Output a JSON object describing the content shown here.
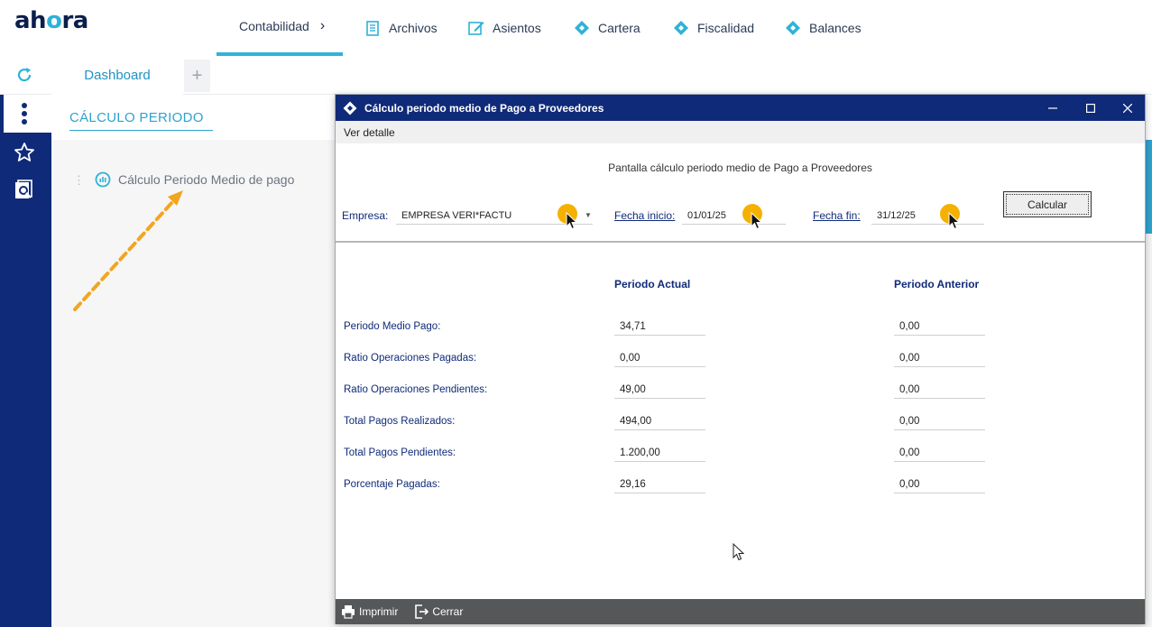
{
  "app": {
    "logo": "ahora"
  },
  "nav": {
    "tabs": [
      {
        "label": "Contabilidad",
        "icon": "chevron-right-icon"
      },
      {
        "label": "Archivos",
        "icon": "document-icon"
      },
      {
        "label": "Asientos",
        "icon": "edit-icon"
      },
      {
        "label": "Cartera",
        "icon": "ahora-diamond-icon"
      },
      {
        "label": "Fiscalidad",
        "icon": "ahora-diamond-icon"
      },
      {
        "label": "Balances",
        "icon": "ahora-diamond-icon"
      }
    ]
  },
  "tabs": {
    "dashboard": "Dashboard",
    "add": "+"
  },
  "main": {
    "section_title": "CÁLCULO PERIODO",
    "menu_item": "Cálculo Periodo Medio de pago"
  },
  "dialog": {
    "title": "Cálculo periodo medio de Pago a Proveedores",
    "menu": "Ver detalle",
    "subtitle": "Pantalla cálculo periodo medio de Pago a Proveedores",
    "empresa_label": "Empresa:",
    "empresa_value": "EMPRESA VERI*FACTU",
    "fecha_inicio_label": "Fecha inicio:",
    "fecha_inicio_value": "01/01/25",
    "fecha_fin_label": "Fecha fin:",
    "fecha_fin_value": "31/12/25",
    "calcular": "Calcular",
    "col_actual": "Periodo Actual",
    "col_anterior": "Periodo Anterior",
    "rows": [
      {
        "label": "Periodo Medio Pago:",
        "actual": "34,71",
        "anterior": "0,00"
      },
      {
        "label": "Ratio Operaciones Pagadas:",
        "actual": "0,00",
        "anterior": "0,00"
      },
      {
        "label": "Ratio Operaciones Pendientes:",
        "actual": "49,00",
        "anterior": "0,00"
      },
      {
        "label": "Total Pagos Realizados:",
        "actual": "494,00",
        "anterior": "0,00"
      },
      {
        "label": "Total Pagos Pendientes:",
        "actual": "1.200,00",
        "anterior": "0,00"
      },
      {
        "label": "Porcentaje Pagadas:",
        "actual": "29,16",
        "anterior": "0,00"
      }
    ],
    "footer": {
      "print": "Imprimir",
      "close": "Cerrar"
    }
  },
  "colors": {
    "brand_navy": "#0f2a78",
    "accent_cyan": "#2fb2d9",
    "highlight": "#f6b100"
  }
}
